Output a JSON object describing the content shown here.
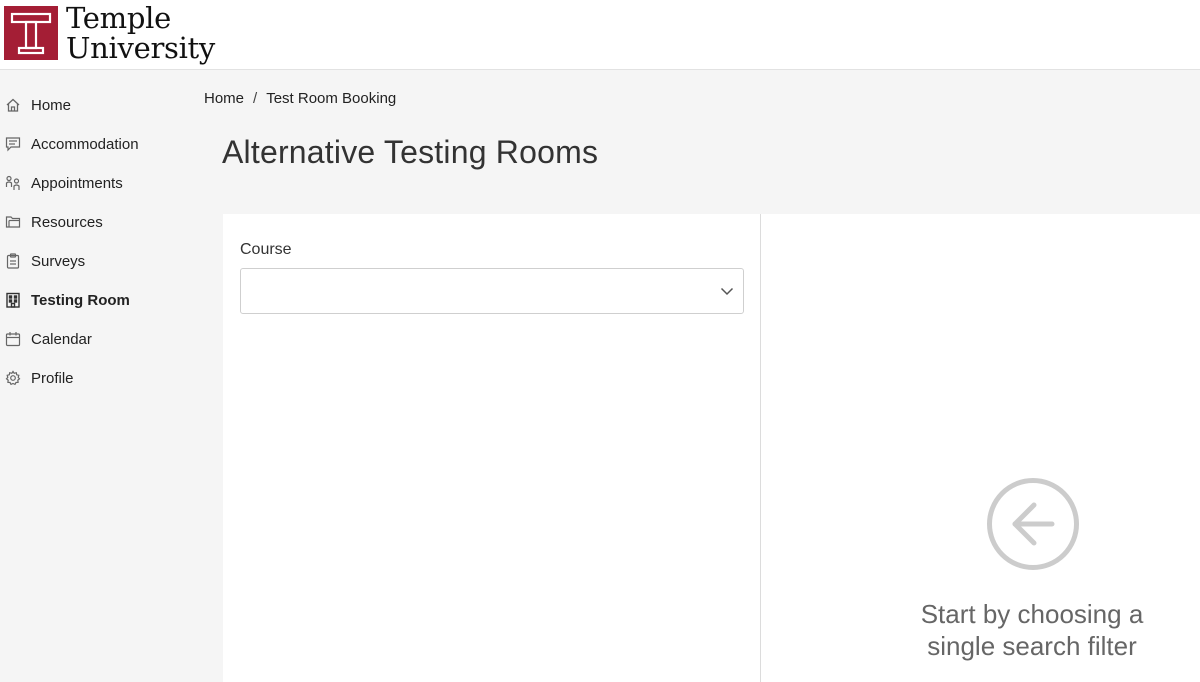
{
  "header": {
    "logo_line1": "Temple",
    "logo_line2": "University"
  },
  "sidebar": {
    "items": [
      {
        "label": "Home",
        "icon": "home-icon"
      },
      {
        "label": "Accommodation",
        "icon": "chat-list-icon"
      },
      {
        "label": "Appointments",
        "icon": "people-icon"
      },
      {
        "label": "Resources",
        "icon": "folder-icon"
      },
      {
        "label": "Surveys",
        "icon": "clipboard-icon"
      },
      {
        "label": "Testing Room",
        "icon": "building-icon",
        "active": true
      },
      {
        "label": "Calendar",
        "icon": "calendar-icon"
      },
      {
        "label": "Profile",
        "icon": "gear-icon"
      }
    ]
  },
  "breadcrumb": {
    "home": "Home",
    "separator": "/",
    "current": "Test Room Booking"
  },
  "page": {
    "title": "Alternative Testing Rooms"
  },
  "filter": {
    "course_label": "Course",
    "course_value": ""
  },
  "empty_state": {
    "message": "Start by choosing a single search filter",
    "icon": "arrow-left-circle-icon"
  },
  "colors": {
    "brand": "#a41e35",
    "background": "#f5f5f5",
    "panel": "#ffffff",
    "empty_icon": "#cccccc"
  }
}
